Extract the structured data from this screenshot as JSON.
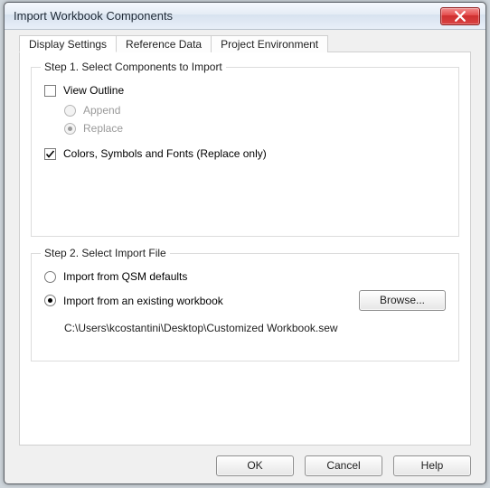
{
  "window": {
    "title": "Import Workbook Components"
  },
  "tabs": {
    "t0": "Display Settings",
    "t1": "Reference Data",
    "t2": "Project Environment"
  },
  "step1": {
    "legend": "Step 1.  Select Components to Import",
    "view_outline": "View Outline",
    "append": "Append",
    "replace": "Replace",
    "colors": "Colors, Symbols and Fonts   (Replace only)"
  },
  "step2": {
    "legend": "Step 2.  Select Import File",
    "from_defaults": "Import from QSM defaults",
    "from_existing": "Import from an existing workbook",
    "browse": "Browse...",
    "path": "C:\\Users\\kcostantini\\Desktop\\Customized Workbook.sew"
  },
  "buttons": {
    "ok": "OK",
    "cancel": "Cancel",
    "help": "Help"
  }
}
